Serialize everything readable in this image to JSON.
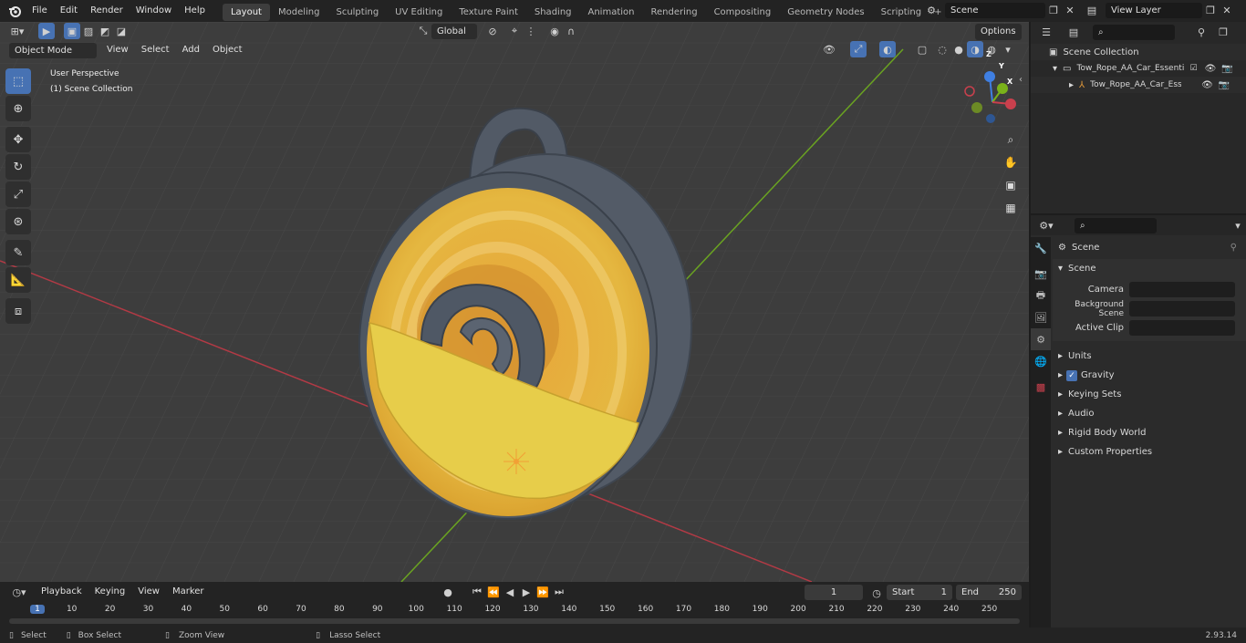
{
  "topbar": {
    "menus": [
      "File",
      "Edit",
      "Render",
      "Window",
      "Help"
    ],
    "workspaces": [
      "Layout",
      "Modeling",
      "Sculpting",
      "UV Editing",
      "Texture Paint",
      "Shading",
      "Animation",
      "Rendering",
      "Compositing",
      "Geometry Nodes",
      "Scripting"
    ],
    "active_workspace": "Layout",
    "add_tab": "+",
    "scene_value": "Scene",
    "view_layer_value": "View Layer"
  },
  "viewport_header": {
    "mode": "Object Mode",
    "menus": [
      "View",
      "Select",
      "Add",
      "Object"
    ],
    "transform_orientation": "Global",
    "options_label": "Options"
  },
  "viewport": {
    "view_name": "User Perspective",
    "collection_name": "(1) Scene Collection",
    "gizmo_axes": {
      "x": "X",
      "y": "Y",
      "z": "Z"
    },
    "colors": {
      "x_axis": "#c9404d",
      "y_axis": "#7ab21a",
      "z_axis": "#3f7fe2",
      "grid_bg": "#3d3d3d",
      "accent": "#4772b3"
    }
  },
  "outliner": {
    "root": "Scene Collection",
    "items": [
      {
        "label": "Tow_Rope_AA_Car_Essentials",
        "level": 1
      },
      {
        "label": "Tow_Rope_AA_Car_Esser",
        "level": 2
      }
    ]
  },
  "properties": {
    "context_title": "Scene",
    "section": "Scene",
    "fields": [
      {
        "label": "Camera",
        "value": ""
      },
      {
        "label": "Background Scene",
        "value": ""
      },
      {
        "label": "Active Clip",
        "value": ""
      }
    ],
    "panels": [
      "Units",
      "Gravity",
      "Keying Sets",
      "Audio",
      "Rigid Body World",
      "Custom Properties"
    ],
    "gravity_checked": true
  },
  "timeline": {
    "menus": [
      "Playback",
      "Keying",
      "View",
      "Marker"
    ],
    "current_frame": "1",
    "start_label": "Start",
    "start_value": "1",
    "end_label": "End",
    "end_value": "250",
    "ticks": [
      "1",
      "10",
      "20",
      "30",
      "40",
      "50",
      "60",
      "70",
      "80",
      "90",
      "100",
      "110",
      "120",
      "130",
      "140",
      "150",
      "160",
      "170",
      "180",
      "190",
      "200",
      "210",
      "220",
      "230",
      "240",
      "250"
    ]
  },
  "statusbar": {
    "items": [
      "Select",
      "Box Select",
      "Zoom View",
      "Lasso Select"
    ],
    "version": "2.93.14"
  }
}
